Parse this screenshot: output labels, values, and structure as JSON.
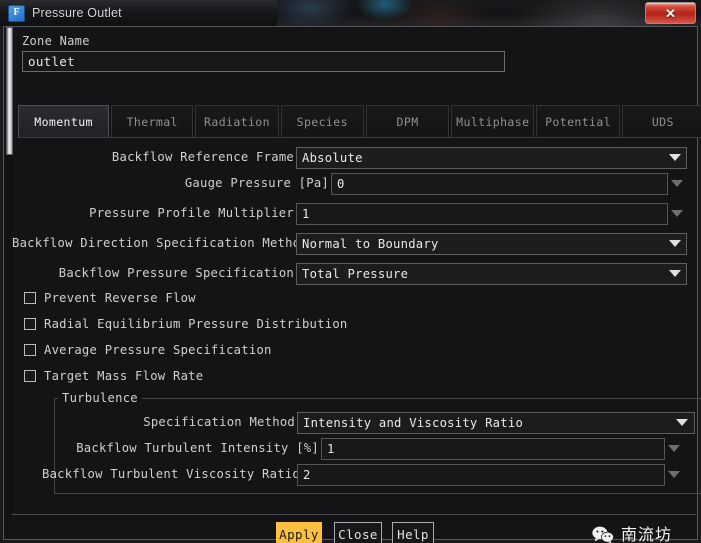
{
  "window": {
    "title": "Pressure Outlet",
    "app_icon": "fluent-f-icon",
    "close_label": "✕"
  },
  "zone": {
    "label": "Zone Name",
    "value": "outlet"
  },
  "tabs": [
    {
      "label": "Momentum",
      "active": true
    },
    {
      "label": "Thermal",
      "active": false
    },
    {
      "label": "Radiation",
      "active": false
    },
    {
      "label": "Species",
      "active": false
    },
    {
      "label": "DPM",
      "active": false
    },
    {
      "label": "Multiphase",
      "active": false
    },
    {
      "label": "Potential",
      "active": false
    },
    {
      "label": "UDS",
      "active": false
    }
  ],
  "fields": {
    "backflow_reference_frame": {
      "label": "Backflow Reference Frame",
      "value": "Absolute",
      "type": "dropdown"
    },
    "gauge_pressure": {
      "label": "Gauge Pressure [Pa]",
      "value": "0",
      "type": "numeric"
    },
    "pressure_profile_multiplier": {
      "label": "Pressure Profile Multiplier",
      "value": "1",
      "type": "numeric"
    },
    "backflow_direction_spec": {
      "label": "Backflow Direction Specification Method",
      "value": "Normal to Boundary",
      "type": "dropdown"
    },
    "backflow_pressure_spec": {
      "label": "Backflow Pressure Specification",
      "value": "Total Pressure",
      "type": "dropdown"
    }
  },
  "checkboxes": [
    {
      "label": "Prevent Reverse Flow",
      "checked": false
    },
    {
      "label": "Radial Equilibrium Pressure Distribution",
      "checked": false
    },
    {
      "label": "Average Pressure Specification",
      "checked": false
    },
    {
      "label": "Target Mass Flow Rate",
      "checked": false
    }
  ],
  "turbulence": {
    "group_title": "Turbulence",
    "specification_method": {
      "label": "Specification Method",
      "value": "Intensity and Viscosity Ratio",
      "type": "dropdown"
    },
    "backflow_turbulent_intensity": {
      "label": "Backflow Turbulent Intensity [%]",
      "value": "1",
      "type": "numeric"
    },
    "backflow_turbulent_viscosity_ratio": {
      "label": "Backflow Turbulent Viscosity Ratio",
      "value": "2",
      "type": "numeric"
    }
  },
  "footer": {
    "apply_label": "Apply",
    "close_label": "Close",
    "help_label": "Help"
  },
  "watermark": {
    "icon": "wechat-icon",
    "text": "南流坊"
  },
  "colors": {
    "accent": "#ffc042",
    "close_red": "#b32318",
    "dialog_bg": "#141416",
    "field_bg": "#18181a",
    "text": "#cfd0d2"
  }
}
